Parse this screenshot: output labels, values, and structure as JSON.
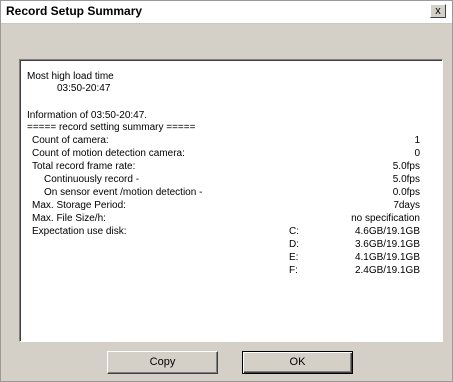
{
  "window": {
    "title": "Record Setup Summary",
    "close_glyph": "x"
  },
  "summary": {
    "load_header": "Most high load time",
    "load_time": "03:50-20:47",
    "info_line": "Information of 03:50-20:47.",
    "section_header": "===== record setting summary =====",
    "rows": [
      {
        "label": "Count of camera:",
        "value": "1"
      },
      {
        "label": "Count of motion detection camera:",
        "value": "0"
      },
      {
        "label": "Total record frame rate:",
        "value": "5.0fps"
      },
      {
        "label": "Continuously record -",
        "value": "5.0fps"
      },
      {
        "label": "On sensor event /motion detection -",
        "value": "0.0fps"
      },
      {
        "label": "Max. Storage Period:",
        "value": "7days"
      },
      {
        "label": "Max. File Size/h:",
        "value": "no specification"
      },
      {
        "label": "Expectation use disk:",
        "value": ""
      }
    ],
    "disks": [
      {
        "drive": "C:",
        "usage": "4.6GB/19.1GB"
      },
      {
        "drive": "D:",
        "usage": "3.6GB/19.1GB"
      },
      {
        "drive": "E:",
        "usage": "4.1GB/19.1GB"
      },
      {
        "drive": "F:",
        "usage": "2.4GB/19.1GB"
      }
    ]
  },
  "buttons": {
    "copy_label": "Copy",
    "ok_label": "OK"
  }
}
